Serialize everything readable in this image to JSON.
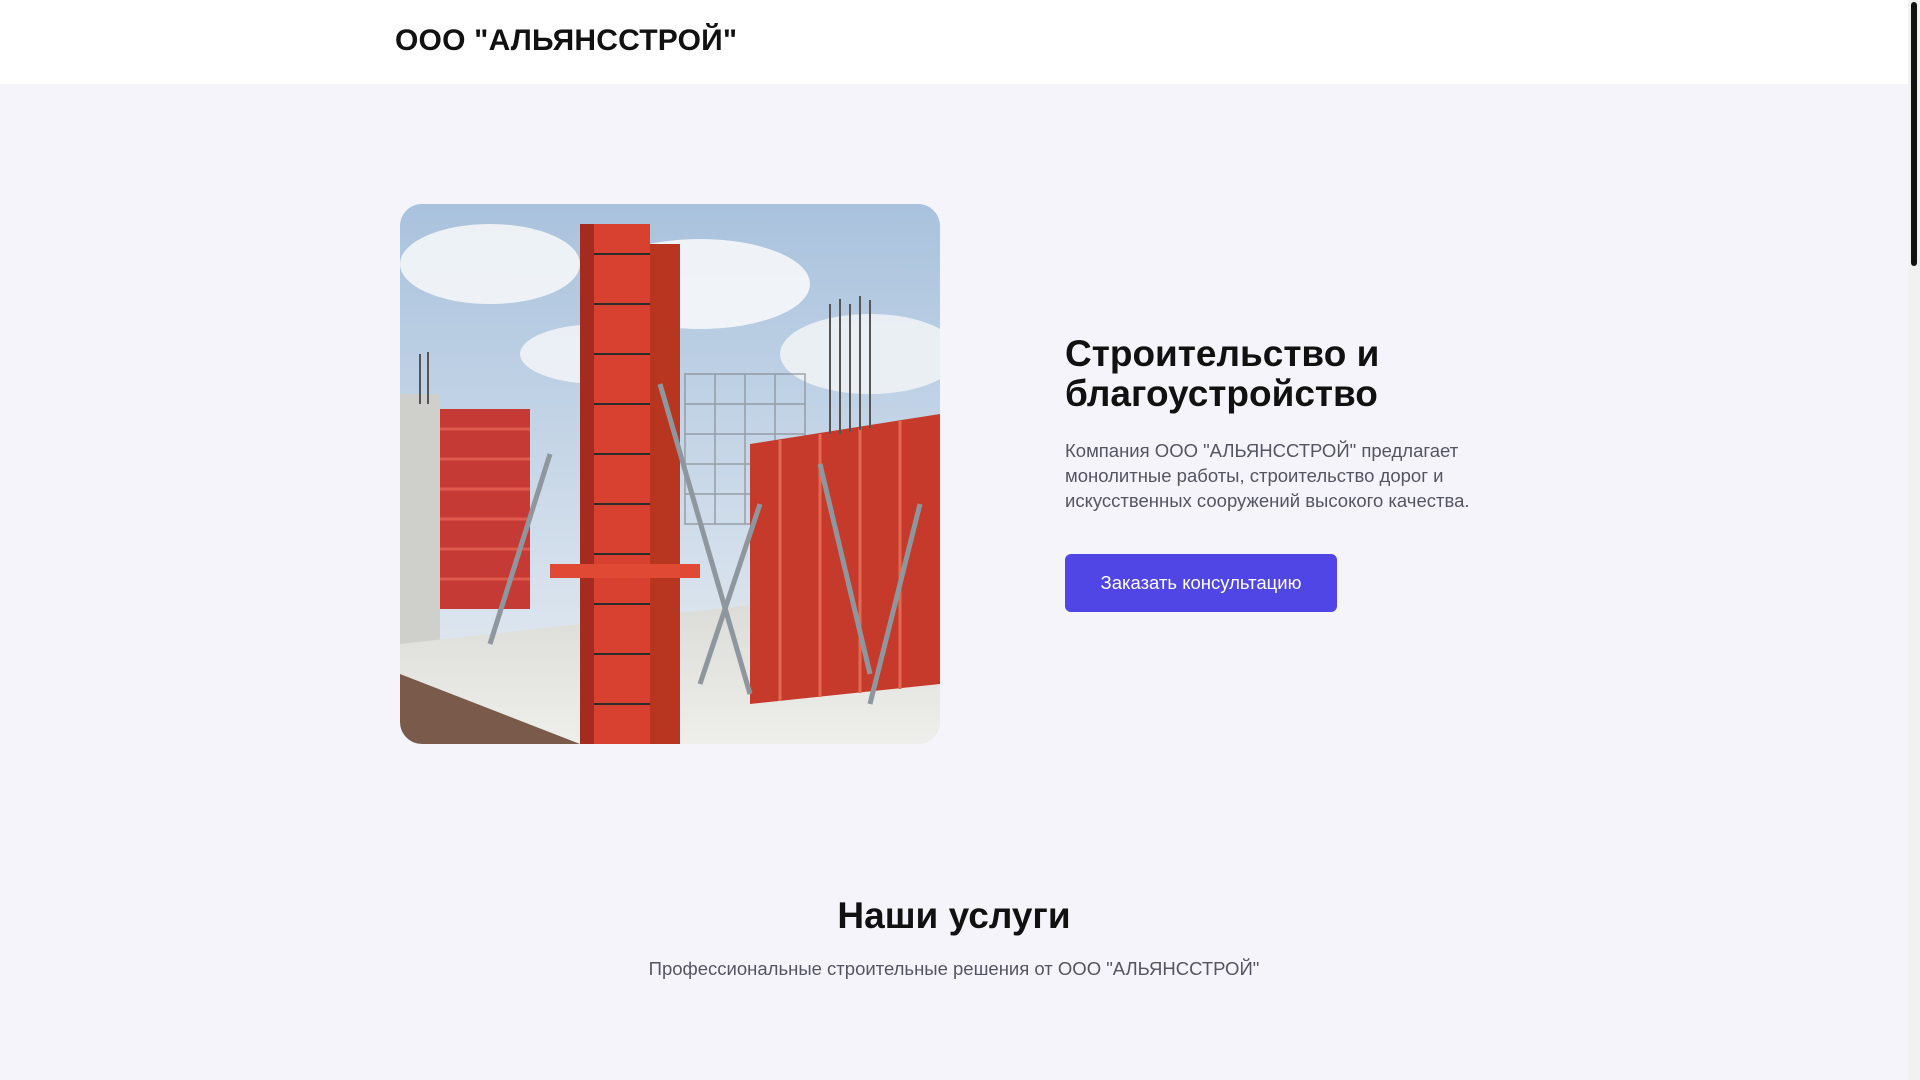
{
  "header": {
    "logo": "ООО \"АЛЬЯНССТРОЙ\""
  },
  "hero": {
    "image_icon": "construction-formwork-photo",
    "title": "Строительство и благоустройство",
    "description": "Компания ООО \"АЛЬЯНССТРОЙ\" предлагает монолитные работы, строительство дорог и искусственных сооружений высокого качества.",
    "cta_label": "Заказать консультацию"
  },
  "services": {
    "title": "Наши услуги",
    "subtitle": "Профессиональные строительные решения от ООО \"АЛЬЯНССТРОЙ\""
  },
  "colors": {
    "accent": "#4f46e5",
    "background": "#f5f4fb",
    "header_bg": "#ffffff"
  }
}
